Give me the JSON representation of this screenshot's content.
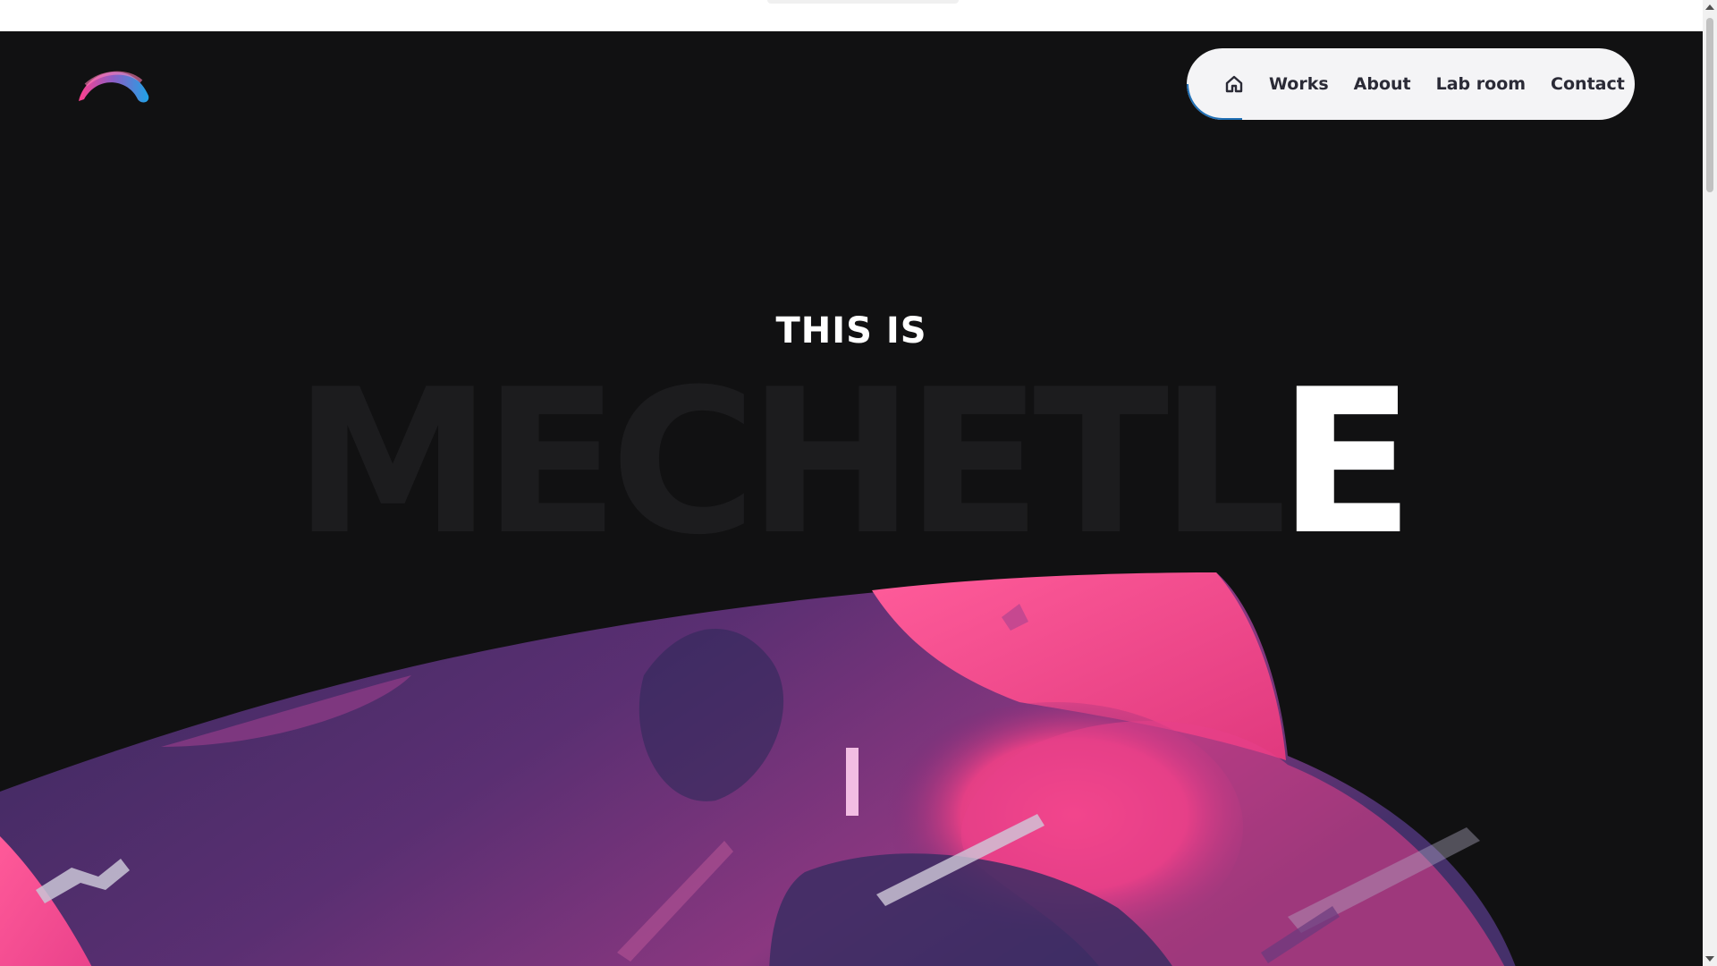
{
  "nav": {
    "home_icon": "home-icon",
    "links": [
      "Works",
      "About",
      "Lab room",
      "Contact"
    ]
  },
  "hero": {
    "pre_title": "THIS IS",
    "name_dim": "MECHETL",
    "name_lit": "E"
  },
  "colors": {
    "background": "#111112",
    "nav_bg": "#f4f4f6",
    "accent_blue": "#1f6fb5",
    "pink": "#ff4d8f",
    "purple": "#4a2e6b"
  },
  "logo": {
    "icon": "rainbow-arc-logo"
  }
}
